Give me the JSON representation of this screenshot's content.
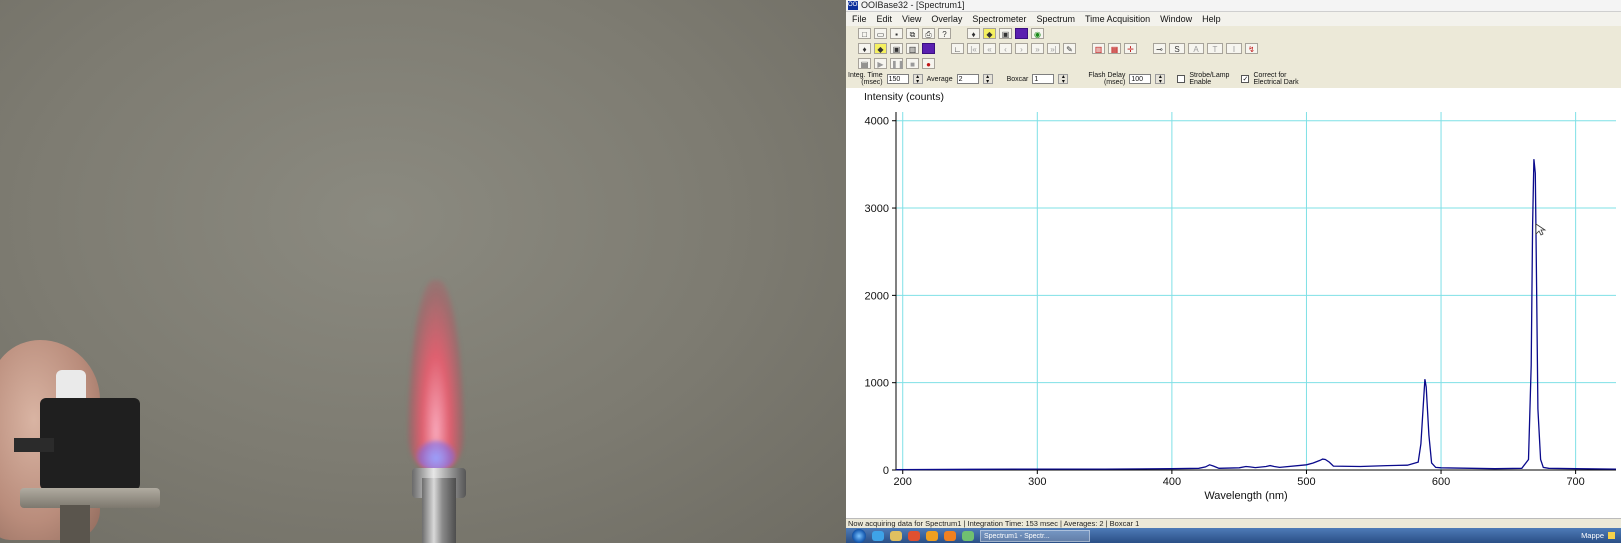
{
  "window": {
    "title": "OOIBase32 - [Spectrum1]",
    "icon_label": "OOI"
  },
  "menu": [
    "File",
    "Edit",
    "View",
    "Overlay",
    "Spectrometer",
    "Spectrum",
    "Time Acquisition",
    "Window",
    "Help"
  ],
  "toolbar_icons": {
    "row1": [
      "new-icon",
      "open-icon",
      "save-icon",
      "copy-icon",
      "print-icon",
      "help-icon",
      "gap",
      "lamp-icon",
      "lamp-on-icon",
      "snapshot-icon",
      "color-icon",
      "eye-icon"
    ],
    "row2": [
      "bulb-icon",
      "bulb-yellow-icon",
      "camera-icon",
      "chart-icon",
      "color-icon",
      "gap",
      "axis-icon",
      "first-icon",
      "prev-fast-icon",
      "prev-icon",
      "next-icon",
      "next-fast-icon",
      "last-icon",
      "pen-icon",
      "gap",
      "grid-icon",
      "grid2-icon",
      "cursor-icon",
      "gap",
      "pin-icon",
      "s-mode-icon",
      "a-mode-icon",
      "t-mode-icon",
      "i-mode-icon",
      "reset-icon"
    ],
    "row3": [
      "acquire-icon",
      "play-icon",
      "pause-icon",
      "stop-icon",
      "record-icon"
    ]
  },
  "params": {
    "integ_time_label1": "Integ. Time",
    "integ_time_label2": "(msec)",
    "integ_time_value": "150",
    "average_label": "Average",
    "average_value": "2",
    "boxcar_label": "Boxcar",
    "boxcar_value": "1",
    "flash_delay_label1": "Flash Delay",
    "flash_delay_label2": "(msec)",
    "flash_delay_value": "100",
    "strobe_label1": "Strobe/Lamp",
    "strobe_label2": "Enable",
    "strobe_checked": false,
    "correct_label1": "Correct for",
    "correct_label2": "Electrical Dark",
    "correct_checked": true
  },
  "chart_data": {
    "type": "line",
    "title": "",
    "ylabel": "Intensity (counts)",
    "xlabel": "Wavelength (nm)",
    "xlim": [
      195,
      730
    ],
    "ylim": [
      0,
      4100
    ],
    "x_ticks": [
      200,
      300,
      400,
      500,
      600,
      700
    ],
    "y_ticks": [
      0,
      1000,
      2000,
      3000,
      4000
    ],
    "grid": true,
    "colors": {
      "line": "#0a0a8c",
      "grid": "#7fe0e6"
    },
    "series": [
      {
        "x": [
          195,
          250,
          300,
          350,
          400,
          420,
          425,
          428,
          431,
          435,
          450,
          455,
          458,
          462,
          470,
          473,
          476,
          480,
          500,
          505,
          510,
          512,
          514,
          517,
          520,
          540,
          560,
          575,
          583,
          585,
          587,
          588,
          589,
          591,
          593,
          596,
          600,
          640,
          660,
          665,
          667,
          668,
          669,
          670,
          671,
          672,
          674,
          676,
          680,
          700,
          730
        ],
        "y": [
          5,
          8,
          10,
          10,
          15,
          20,
          35,
          60,
          45,
          20,
          25,
          40,
          35,
          28,
          40,
          50,
          40,
          30,
          60,
          80,
          110,
          125,
          120,
          90,
          45,
          40,
          50,
          55,
          90,
          300,
          800,
          1040,
          950,
          400,
          80,
          30,
          25,
          15,
          20,
          120,
          1200,
          2800,
          3560,
          3400,
          2100,
          700,
          120,
          30,
          20,
          15,
          10
        ]
      }
    ]
  },
  "status": "Now acquiring data for Spectrum1 | Integration Time: 153 msec | Averages: 2 | Boxcar 1",
  "taskbar": {
    "app_label": "Spectrum1 - Spectr...",
    "tray_text": "Mappe"
  }
}
